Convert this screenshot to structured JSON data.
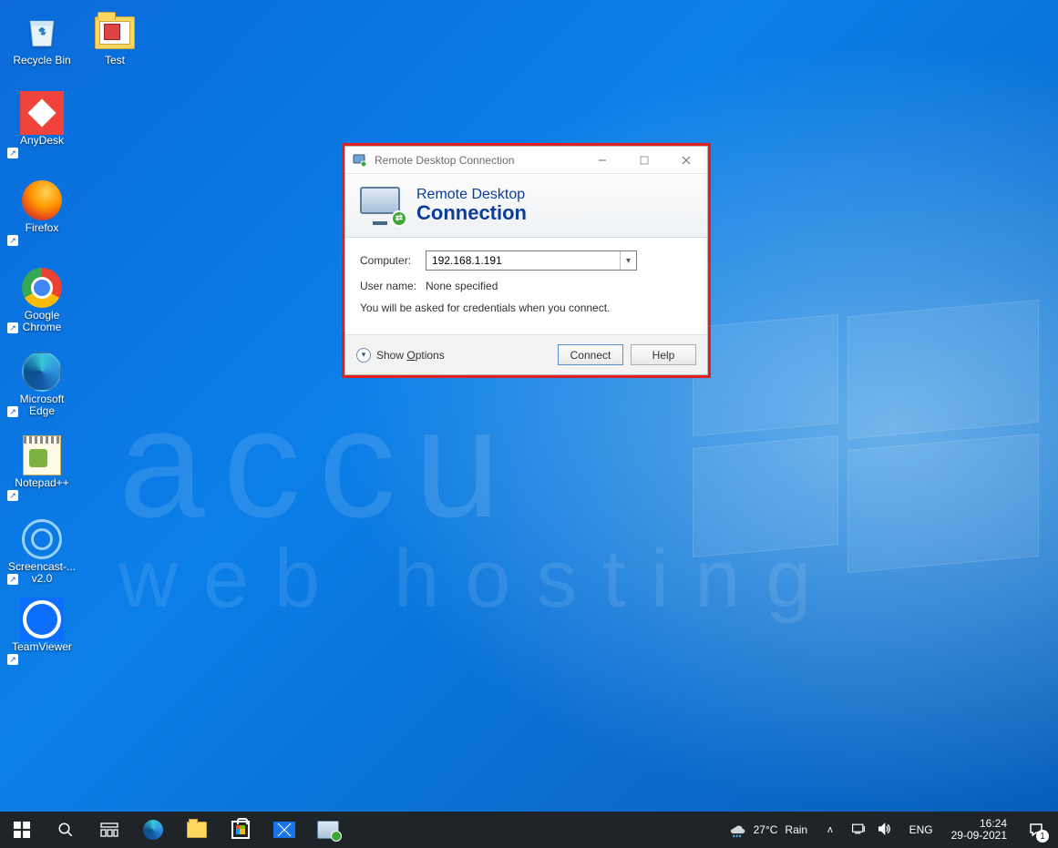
{
  "desktop_icons": {
    "recycle_bin": "Recycle Bin",
    "test": "Test",
    "anydesk": "AnyDesk",
    "firefox": "Firefox",
    "chrome": "Google Chrome",
    "edge": "Microsoft Edge",
    "notepadpp": "Notepad++",
    "screencast": "Screencast-... v2.0",
    "teamviewer": "TeamViewer"
  },
  "watermark": {
    "line1": "accu",
    "line2": "web hosting"
  },
  "rdp": {
    "title": "Remote Desktop Connection",
    "banner_line1": "Remote Desktop",
    "banner_line2": "Connection",
    "label_computer": "Computer:",
    "computer_value": "192.168.1.191",
    "label_user": "User name:",
    "user_value": "None specified",
    "hint": "You will be asked for credentials when you connect.",
    "show_options_prefix": "Show ",
    "show_options_underline": "O",
    "show_options_suffix": "ptions",
    "connect": "Connect",
    "help": "Help"
  },
  "taskbar": {
    "weather_temp": "27°C",
    "weather_cond": "Rain",
    "lang": "ENG",
    "time": "16:24",
    "date": "29-09-2021",
    "notif_count": "1"
  }
}
